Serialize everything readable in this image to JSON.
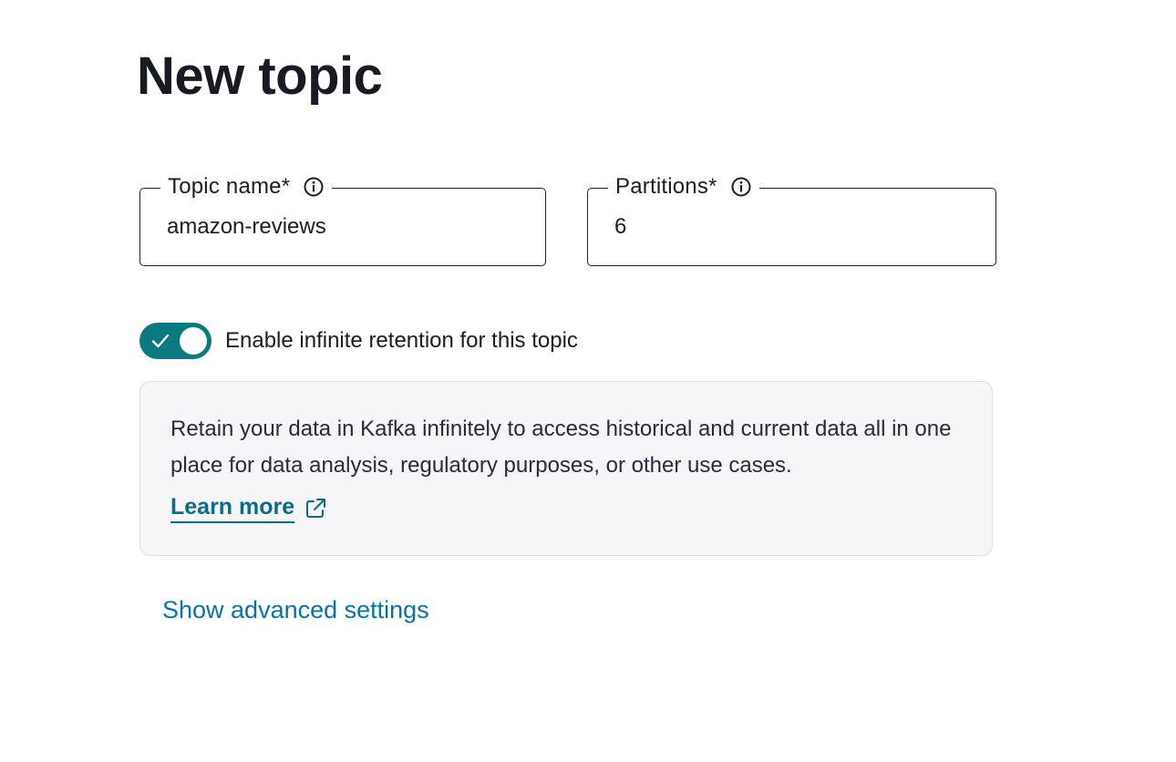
{
  "page": {
    "title": "New topic"
  },
  "form": {
    "topic_name": {
      "label": "Topic name*",
      "value": "amazon-reviews",
      "info_icon": "info-circle-icon"
    },
    "partitions": {
      "label": "Partitions*",
      "value": "6",
      "info_icon": "info-circle-icon"
    }
  },
  "retention": {
    "toggle_on": true,
    "toggle_icon": "check-icon",
    "label": "Enable infinite retention for this topic",
    "info_text": "Retain your data in Kafka infinitely to access historical and current data all in one place for data analysis, regulatory purposes, or other use cases.",
    "learn_more_label": "Learn more",
    "learn_more_icon": "external-link-icon"
  },
  "advanced": {
    "label": "Show advanced settings"
  },
  "colors": {
    "toggle_on": "#0b7a80",
    "link": "#0a73a6",
    "learn_more": "#0b6b8a",
    "panel_bg": "#f6f6f9"
  }
}
